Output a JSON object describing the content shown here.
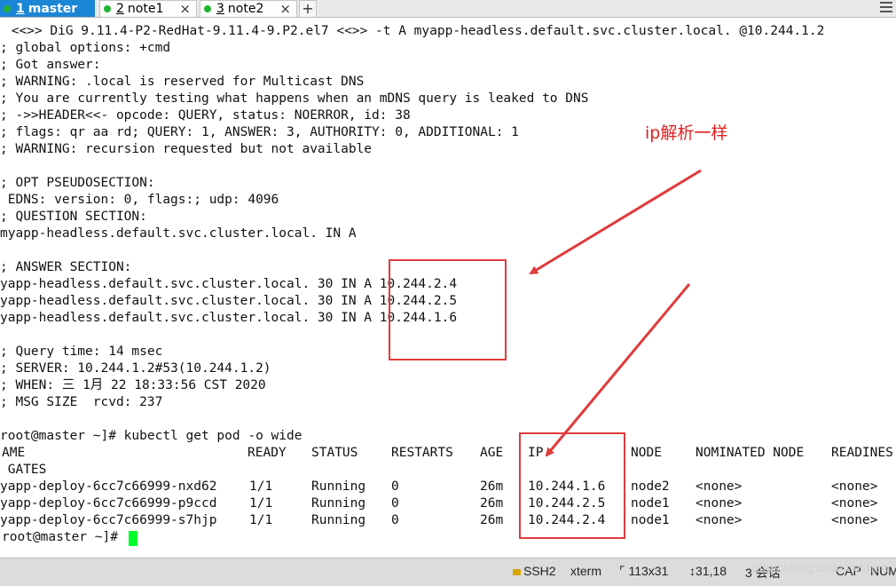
{
  "tabs": [
    {
      "num": "1",
      "label": "master",
      "active": true
    },
    {
      "num": "2",
      "label": "note1",
      "active": false
    },
    {
      "num": "3",
      "label": "note2",
      "active": false
    }
  ],
  "tab_close": "×",
  "add_tab": "+",
  "terminal": {
    "lines": [
      " <<>> DiG 9.11.4-P2-RedHat-9.11.4-9.P2.el7 <<>> -t A myapp-headless.default.svc.cluster.local. @10.244.1.2",
      "; global options: +cmd",
      "; Got answer:",
      "; WARNING: .local is reserved for Multicast DNS",
      "; You are currently testing what happens when an mDNS query is leaked to DNS",
      "; ->>HEADER<<- opcode: QUERY, status: NOERROR, id: 38",
      "; flags: qr aa rd; QUERY: 1, ANSWER: 3, AUTHORITY: 0, ADDITIONAL: 1",
      "; WARNING: recursion requested but not available",
      "",
      "; OPT PSEUDOSECTION:",
      " EDNS: version: 0, flags:; udp: 4096",
      "; QUESTION SECTION:",
      "myapp-headless.default.svc.cluster.local. IN A",
      "",
      "; ANSWER SECTION:",
      "yapp-headless.default.svc.cluster.local. 30 IN A 10.244.2.4",
      "yapp-headless.default.svc.cluster.local. 30 IN A 10.244.2.5",
      "yapp-headless.default.svc.cluster.local. 30 IN A 10.244.1.6",
      "",
      "; Query time: 14 msec",
      "; SERVER: 10.244.1.2#53(10.244.1.2)",
      "; WHEN: 三 1月 22 18:33:56 CST 2020",
      "; MSG SIZE  rcvd: 237",
      "",
      "root@master ~]# kubectl get pod -o wide"
    ],
    "pod_table": {
      "headers": [
        "AME",
        "READY",
        "STATUS",
        "RESTARTS",
        "AGE",
        "IP",
        "NODE",
        "NOMINATED NODE",
        "READINES"
      ],
      "header_wrap": " GATES",
      "rows": [
        [
          "yapp-deploy-6cc7c66999-nxd62",
          "1/1",
          "Running",
          "0",
          "26m",
          "10.244.1.6",
          "node2",
          "<none>",
          "<none>"
        ],
        [
          "yapp-deploy-6cc7c66999-p9ccd",
          "1/1",
          "Running",
          "0",
          "26m",
          "10.244.2.5",
          "node1",
          "<none>",
          "<none>"
        ],
        [
          "yapp-deploy-6cc7c66999-s7hjp",
          "1/1",
          "Running",
          "0",
          "26m",
          "10.244.2.4",
          "node1",
          "<none>",
          "<none>"
        ]
      ]
    },
    "prompt": "root@master ~]# "
  },
  "annotation": {
    "text": "ip解析一样",
    "color": "#e02020"
  },
  "statusbar": {
    "protocol": "SSH2",
    "terminal_type": "xterm",
    "size": "113x31",
    "cursor_pos": "31,18",
    "sessions": "3 会话",
    "cap": "CAP",
    "num": "NUM",
    "watermark": "https://blog.csdn.net/hea"
  }
}
